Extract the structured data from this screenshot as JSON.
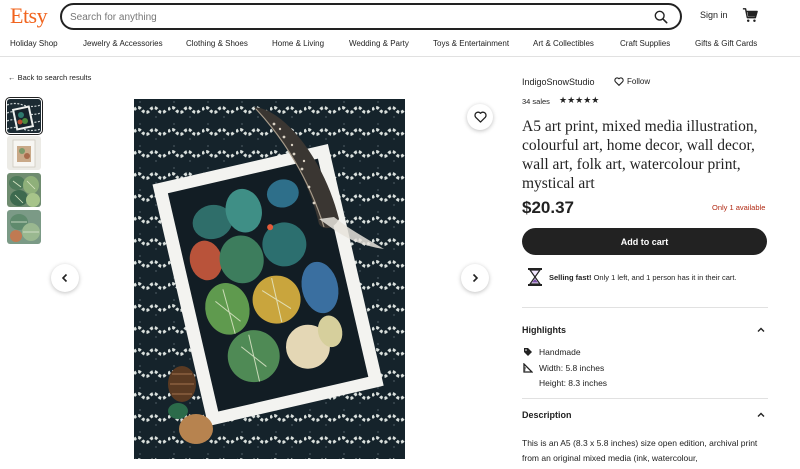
{
  "header": {
    "logo": "Etsy",
    "search_placeholder": "Search for anything",
    "signin_label": "Sign in"
  },
  "nav": {
    "items": [
      "Holiday Shop",
      "Jewelry & Accessories",
      "Clothing & Shoes",
      "Home & Living",
      "Wedding & Party",
      "Toys & Entertainment",
      "Art & Collectibles",
      "Craft Supplies",
      "Gifts & Gift Cards"
    ]
  },
  "back_link": "Back to search results",
  "listing": {
    "shop_name": "IndigoSnowStudio",
    "follow_label": "Follow",
    "sales": "34 sales",
    "rating": 5,
    "stars": "★★★★★",
    "title": "A5 art print, mixed media illustration, colourful art, home decor, wall decor, wall art, folk art, watercolour print, mystical art",
    "price": "$20.37",
    "availability": "Only 1 available",
    "add_to_cart_label": "Add to cart",
    "selling_fast_bold": "Selling fast!",
    "selling_fast_text": " Only 1 left, and 1 person has it in their cart."
  },
  "highlights": {
    "heading": "Highlights",
    "items": [
      "Handmade",
      "Width: 5.8 inches",
      "Height: 8.3 inches"
    ]
  },
  "description": {
    "heading": "Description",
    "text": "This is an A5 (8.3 x 5.8 inches) size open edition, archival print from an original mixed media (ink, watercolour,"
  },
  "colors": {
    "brand": "#f1641e",
    "availability": "#b12a14",
    "button_bg": "#222222"
  }
}
